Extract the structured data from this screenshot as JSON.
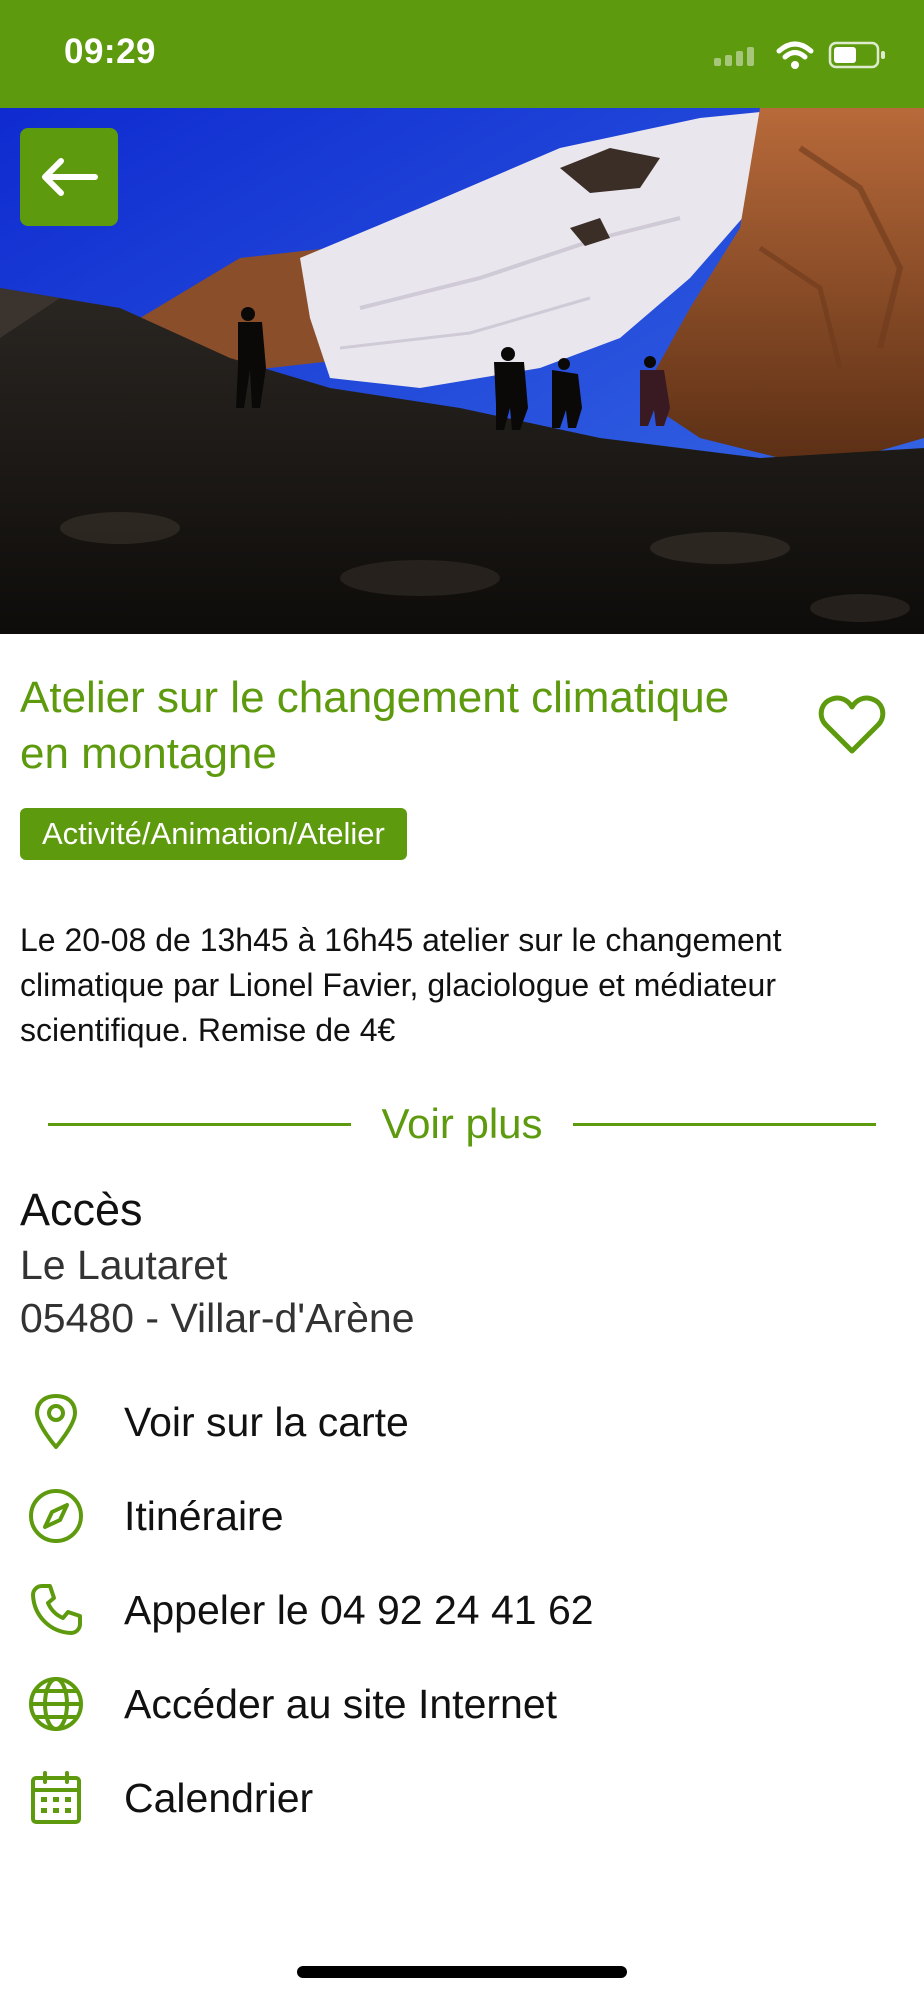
{
  "status": {
    "time": "09:29"
  },
  "header": {
    "back_icon": "arrow-left-icon"
  },
  "event": {
    "title": "Atelier sur le changement climatique en montagne",
    "favorite_icon": "heart-outline-icon",
    "category": "Activité/Animation/Atelier",
    "description": "Le 20-08 de 13h45 à 16h45 atelier sur le changement climatique par Lionel Favier, glaciologue et médiateur scientifique. Remise de 4€",
    "more_label": "Voir plus"
  },
  "access": {
    "title": "Accès",
    "line1": "Le Lautaret",
    "line2": "05480 - Villar-d'Arène"
  },
  "actions": [
    {
      "icon": "map-pin-icon",
      "label": "Voir sur la carte"
    },
    {
      "icon": "compass-icon",
      "label": "Itinéraire"
    },
    {
      "icon": "phone-icon",
      "label": "Appeler le 04 92 24 41 62"
    },
    {
      "icon": "globe-icon",
      "label": "Accéder au site Internet"
    },
    {
      "icon": "calendar-icon",
      "label": "Calendrier"
    }
  ],
  "colors": {
    "brand_green": "#5e9a0e",
    "text": "#111111",
    "background": "#ffffff"
  }
}
